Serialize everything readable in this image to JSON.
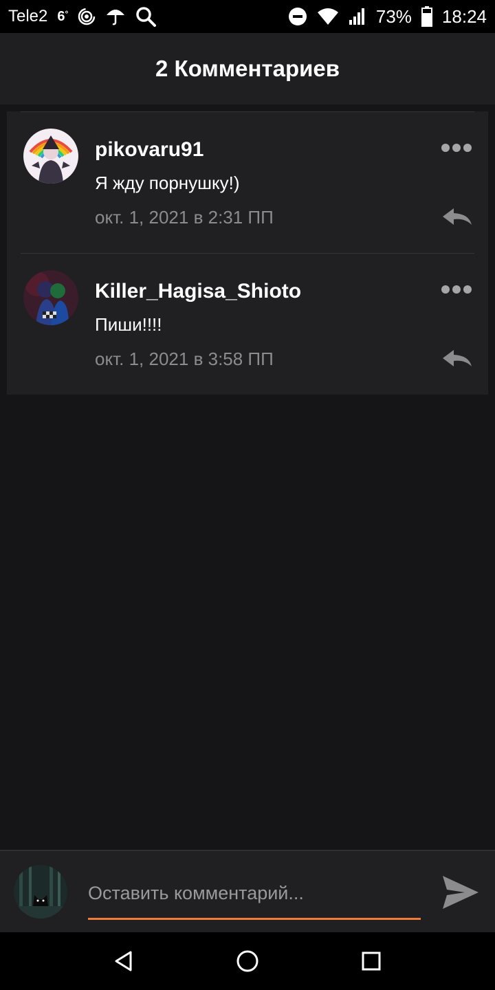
{
  "status_bar": {
    "carrier": "Tele2",
    "network": "6",
    "battery": "73%",
    "time": "18:24",
    "icons": [
      "hotspot-icon",
      "umbrella-icon",
      "search-icon",
      "dnd-icon",
      "wifi-icon",
      "signal-icon",
      "battery-icon"
    ]
  },
  "header": {
    "title": "2 Комментариев"
  },
  "comments": [
    {
      "username": "pikovaru91",
      "text": "Я жду порнушку!)",
      "date": "окт. 1, 2021 в 2:31 ПП"
    },
    {
      "username": "Killer_Hagisa_Shioto",
      "text": "Пиши!!!!",
      "date": "окт. 1, 2021 в 3:58 ПП"
    }
  ],
  "input": {
    "placeholder": "Оставить комментарий..."
  },
  "colors": {
    "accent": "#f07a3a",
    "background": "#151416",
    "card": "#201f21",
    "muted": "#8c8b8d"
  }
}
